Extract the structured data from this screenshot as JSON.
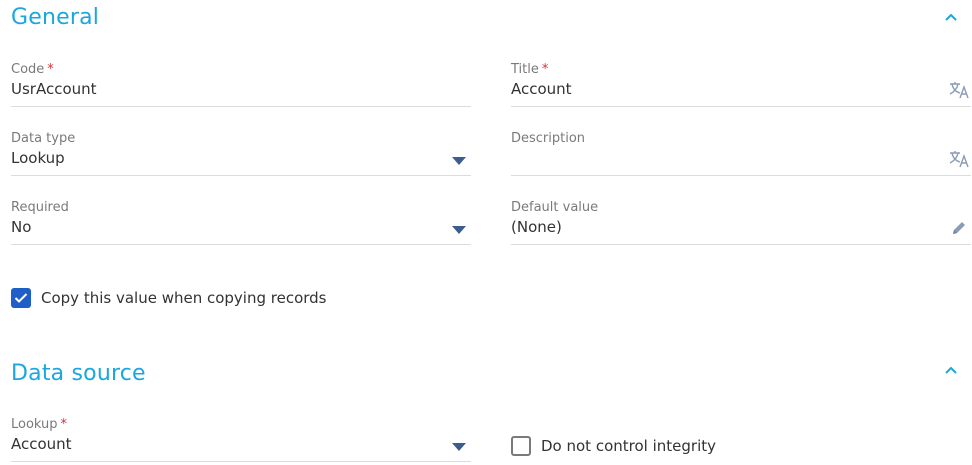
{
  "sections": {
    "general": {
      "title": "General",
      "fields": {
        "code": {
          "label": "Code",
          "required_mark": "*",
          "value": "UsrAccount"
        },
        "title": {
          "label": "Title",
          "required_mark": "*",
          "value": "Account"
        },
        "data_type": {
          "label": "Data type",
          "value": "Lookup"
        },
        "description": {
          "label": "Description",
          "value": ""
        },
        "required": {
          "label": "Required",
          "value": "No"
        },
        "default_value": {
          "label": "Default value",
          "value": "(None)"
        }
      },
      "copy_checkbox": {
        "label": "Copy this value when copying records",
        "checked": true
      }
    },
    "data_source": {
      "title": "Data source",
      "fields": {
        "lookup": {
          "label": "Lookup",
          "required_mark": "*",
          "value": "Account"
        }
      },
      "integrity_checkbox": {
        "label": "Do not control integrity",
        "checked": false
      }
    }
  },
  "icons": {
    "collapse": "chevron-up-icon",
    "translate": "translate-icon",
    "dropdown": "dropdown-arrow-icon",
    "edit": "pencil-icon",
    "check": "checkmark-icon"
  },
  "colors": {
    "accent": "#1aa7df",
    "required": "#d33232",
    "checkbox": "#1f5ec9",
    "label": "#7a7a7a",
    "text": "#333333"
  }
}
